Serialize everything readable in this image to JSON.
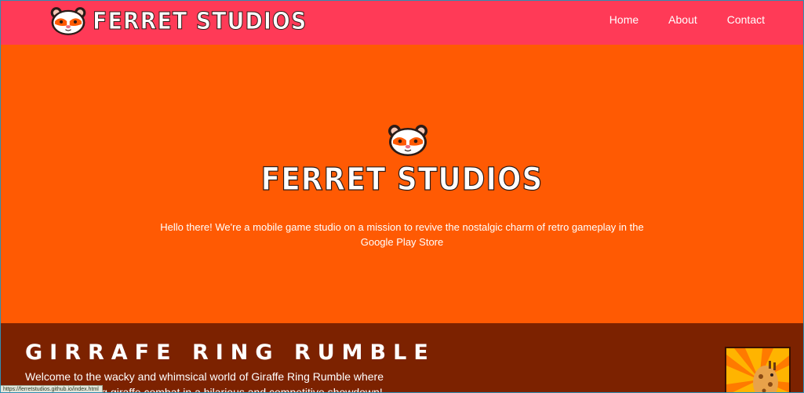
{
  "header": {
    "brand_name": "FERRET STUDIOS",
    "logo_icon": "ferret-logo-icon",
    "nav": [
      {
        "label": "Home"
      },
      {
        "label": "About"
      },
      {
        "label": "Contact"
      }
    ]
  },
  "hero": {
    "logo_icon": "ferret-logo-icon",
    "title": "FERRET STUDIOS",
    "text": "Hello there! We're a mobile game studio on a mission to revive the nostalgic charm of retro gameplay in the Google Play Store"
  },
  "game": {
    "title": "GIRRAFE RING RUMBLE",
    "description": "Welcome to the wacky and whimsical world of Giraffe Ring Rumble where the laws of string giraffe combat in a hilarious and competitive showdown!",
    "thumbnail_icon": "giraffe-game-icon"
  },
  "status_bar": {
    "url": "https://ferretstudios.github.io/index.html"
  },
  "colors": {
    "header_bg": "#ff3a57",
    "hero_bg": "#ff5a03",
    "game_bg": "#7c2200"
  }
}
